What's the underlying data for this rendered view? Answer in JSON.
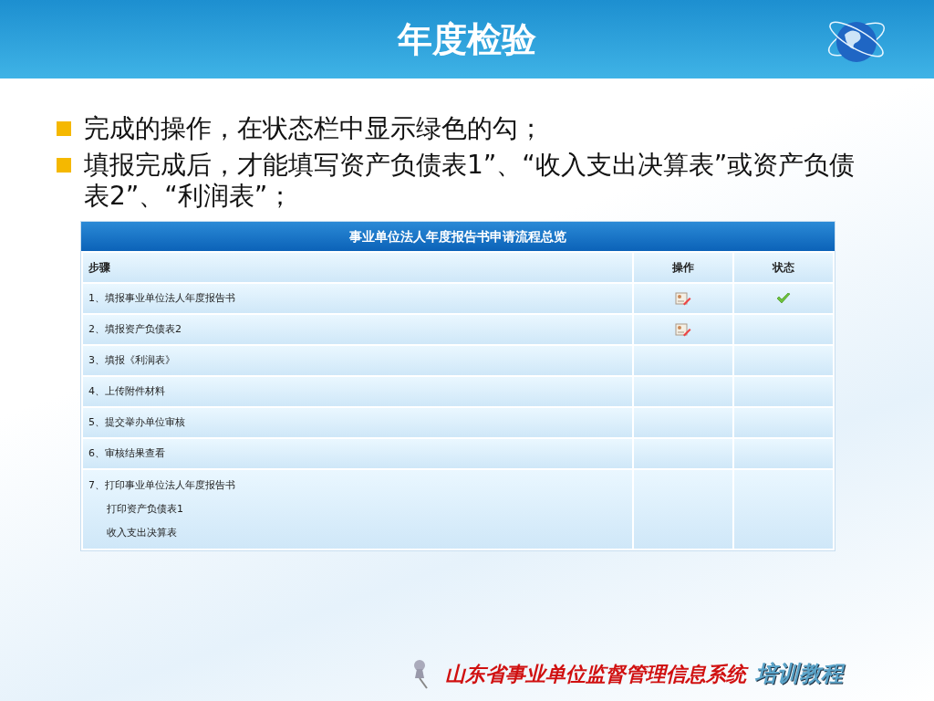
{
  "slide_title": "年度检验",
  "bullets": [
    "完成的操作，在状态栏中显示绿色的勾；",
    "填报完成后，才能填写资产负债表1”、“收入支出决算表”或资产负债表2”、“利润表”；"
  ],
  "table": {
    "title": "事业单位法人年度报告书申请流程总览",
    "columns": [
      "步骤",
      "操作",
      "状态"
    ],
    "rows": [
      {
        "lines": [
          "1、填报事业单位法人年度报告书"
        ],
        "has_action": true,
        "done": true
      },
      {
        "lines": [
          "2、填报资产负债表2"
        ],
        "has_action": true,
        "done": false
      },
      {
        "lines": [
          "3、填报《利润表》"
        ],
        "has_action": false,
        "done": false
      },
      {
        "lines": [
          "4、上传附件材料"
        ],
        "has_action": false,
        "done": false
      },
      {
        "lines": [
          "5、提交举办单位审核"
        ],
        "has_action": false,
        "done": false
      },
      {
        "lines": [
          "6、审核结果查看"
        ],
        "has_action": false,
        "done": false
      },
      {
        "lines": [
          "7、打印事业单位法人年度报告书",
          "打印资产负债表1",
          "收入支出决算表"
        ],
        "has_action": false,
        "done": false
      }
    ]
  },
  "footer": {
    "system": "山东省事业单位监督管理信息系统",
    "tag": "培训教程"
  }
}
